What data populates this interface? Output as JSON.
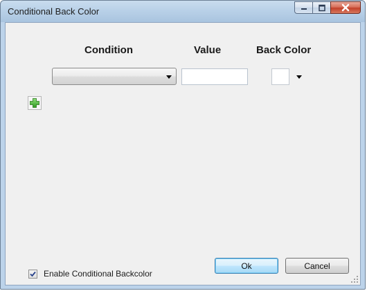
{
  "window": {
    "title": "Conditional Back Color"
  },
  "caption_buttons": {
    "minimize_icon": "minimize-icon",
    "maximize_icon": "maximize-icon",
    "close_icon": "close-icon"
  },
  "headers": {
    "condition": "Condition",
    "value": "Value",
    "back_color": "Back Color"
  },
  "row": {
    "condition_selected": "",
    "value": "",
    "back_color": "#ffffff"
  },
  "add_button": {
    "icon": "plus-icon",
    "color": "#2f9a21"
  },
  "footer": {
    "enable_label": "Enable Conditional Backcolor",
    "enable_checked": true,
    "ok_label": "Ok",
    "cancel_label": "Cancel"
  },
  "colors": {
    "title_bar": "#b9d1e8",
    "client_bg": "#f0f0f0",
    "close_button": "#c2412a",
    "default_button_border": "#3c7fb1"
  }
}
